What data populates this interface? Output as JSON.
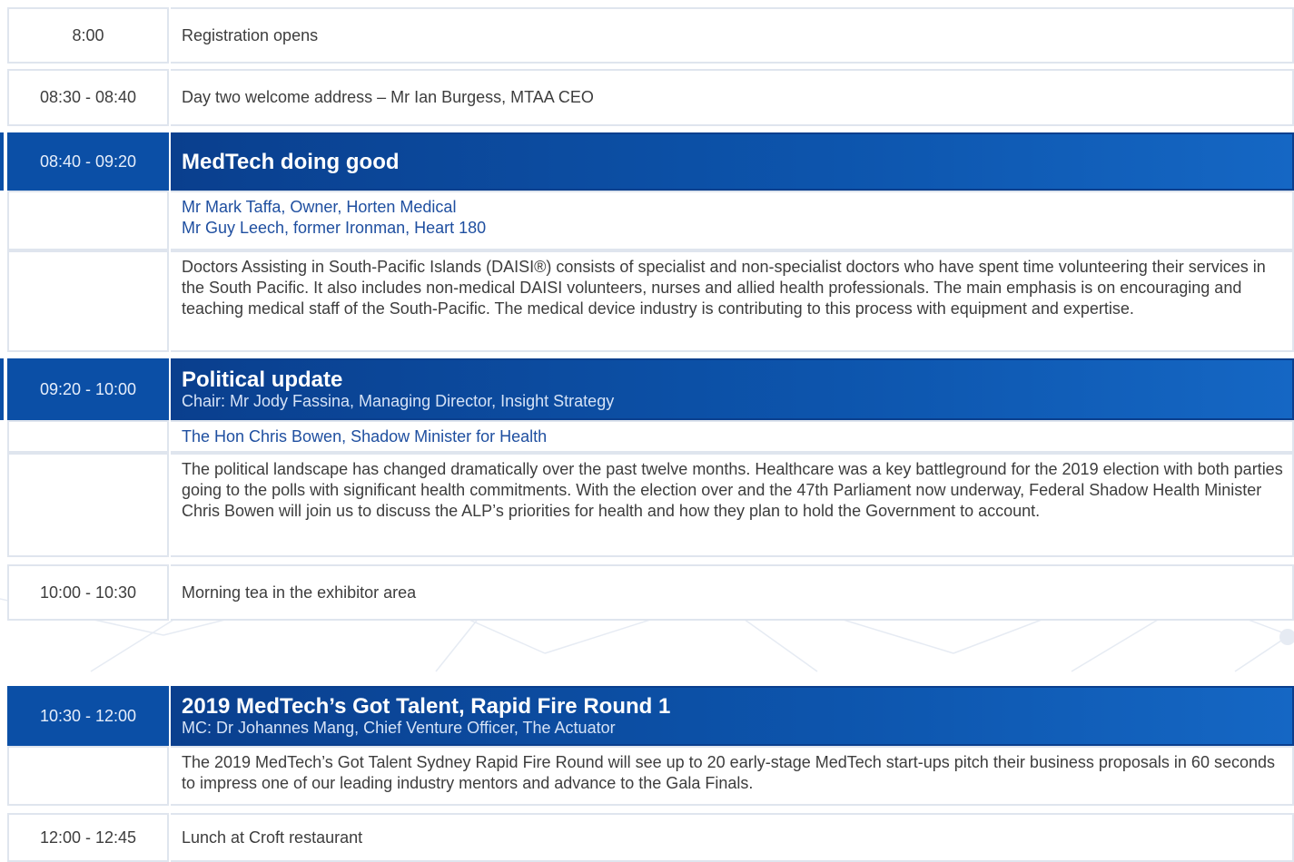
{
  "schedule": [
    {
      "time": "8:00",
      "text": "Registration opens"
    },
    {
      "time": "08:30 - 08:40",
      "text": "Day two welcome address  – Mr Ian Burgess, MTAA CEO"
    },
    {
      "time": "08:40 - 09:20",
      "title": "MedTech doing good",
      "speakers": [
        "Mr Mark Taffa, Owner, Horten Medical",
        "Mr Guy Leech, former Ironman, Heart 180"
      ],
      "description": "Doctors Assisting in South-Pacific Islands (DAISI®) consists of specialist and non-specialist doctors who have spent time volunteering their services in the South Pacific. It also includes non-medical DAISI volunteers, nurses and allied health professionals. The main emphasis is on encouraging and teaching medical staff of the South-Pacific. The medical device industry is contributing to this process with equipment and expertise."
    },
    {
      "time": "09:20 - 10:00",
      "title": "Political update",
      "chair": "Chair: Mr Jody Fassina, Managing Director, Insight Strategy",
      "speakers": [
        "The Hon Chris Bowen, Shadow Minister for Health"
      ],
      "description": "The political landscape has changed dramatically over the past twelve months. Healthcare was a key battleground for the 2019 election with both parties going to the polls with significant health commitments. With the election over and the 47th Parliament now underway, Federal Shadow Health Minister Chris Bowen will join us to discuss the ALP’s priorities for health and how they plan to hold the Government to account."
    },
    {
      "time": "10:00 - 10:30",
      "text": "Morning tea in the exhibitor area"
    },
    {
      "time": "10:30 - 12:00",
      "title": "2019 MedTech’s Got Talent, Rapid Fire Round 1",
      "chair": "MC: Dr Johannes Mang, Chief Venture Officer, The Actuator",
      "description": "The 2019 MedTech’s Got Talent Sydney Rapid Fire Round will see up to 20 early-stage MedTech start-ups pitch their business proposals in 60 seconds to impress one of our leading industry mentors and advance to the Gala Finals."
    },
    {
      "time": "12:00 - 12:45",
      "text": "Lunch at Croft restaurant"
    }
  ]
}
